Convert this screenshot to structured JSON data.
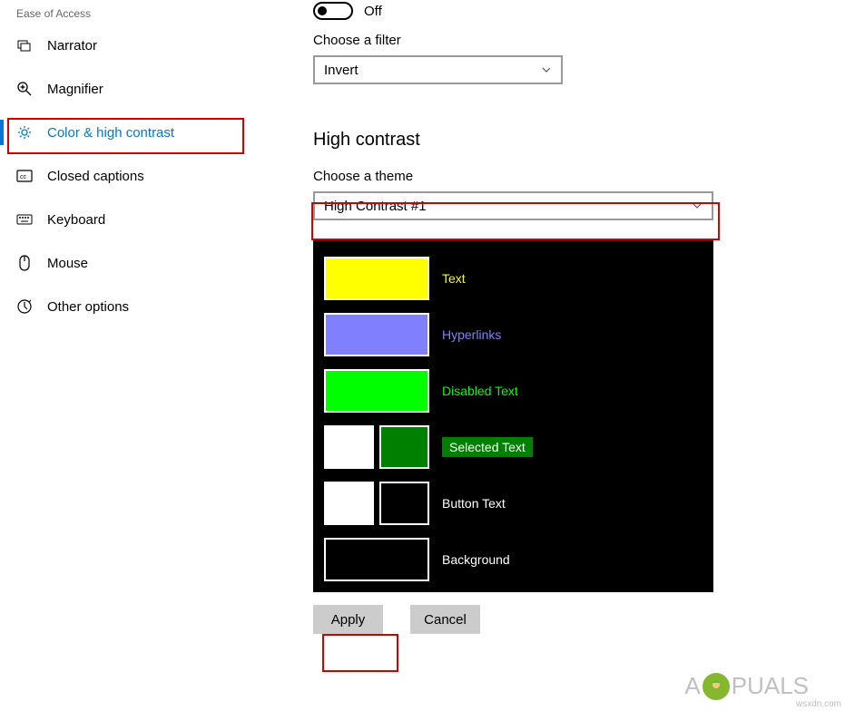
{
  "sidebar": {
    "title": "Ease of Access",
    "items": [
      {
        "label": "Narrator"
      },
      {
        "label": "Magnifier"
      },
      {
        "label": "Color & high contrast",
        "active": true
      },
      {
        "label": "Closed captions"
      },
      {
        "label": "Keyboard"
      },
      {
        "label": "Mouse"
      },
      {
        "label": "Other options"
      }
    ]
  },
  "toggle": {
    "state_label": "Off"
  },
  "filter": {
    "label": "Choose a filter",
    "value": "Invert"
  },
  "high_contrast": {
    "heading": "High contrast",
    "theme_label": "Choose a theme",
    "theme_value": "High Contrast #1",
    "preview": {
      "text": {
        "color": "#ffff00",
        "label": "Text",
        "label_color": "#ffff00"
      },
      "hyperlinks": {
        "color": "#8080ff",
        "label": "Hyperlinks",
        "label_color": "#8080ff"
      },
      "disabled_text": {
        "color": "#00ff00",
        "label": "Disabled Text",
        "label_color": "#00ff00"
      },
      "selected_text": {
        "fg": "#ffffff",
        "bg": "#008000",
        "label": "Selected Text"
      },
      "button_text": {
        "fg": "#ffffff",
        "bg": "#000000",
        "label": "Button Text",
        "label_color": "#ffffff"
      },
      "background": {
        "color": "#000000",
        "label": "Background",
        "label_color": "#ffffff"
      }
    }
  },
  "buttons": {
    "apply": "Apply",
    "cancel": "Cancel"
  },
  "watermark": {
    "brand": "A   PUALS",
    "url": "wsxdn.com"
  }
}
